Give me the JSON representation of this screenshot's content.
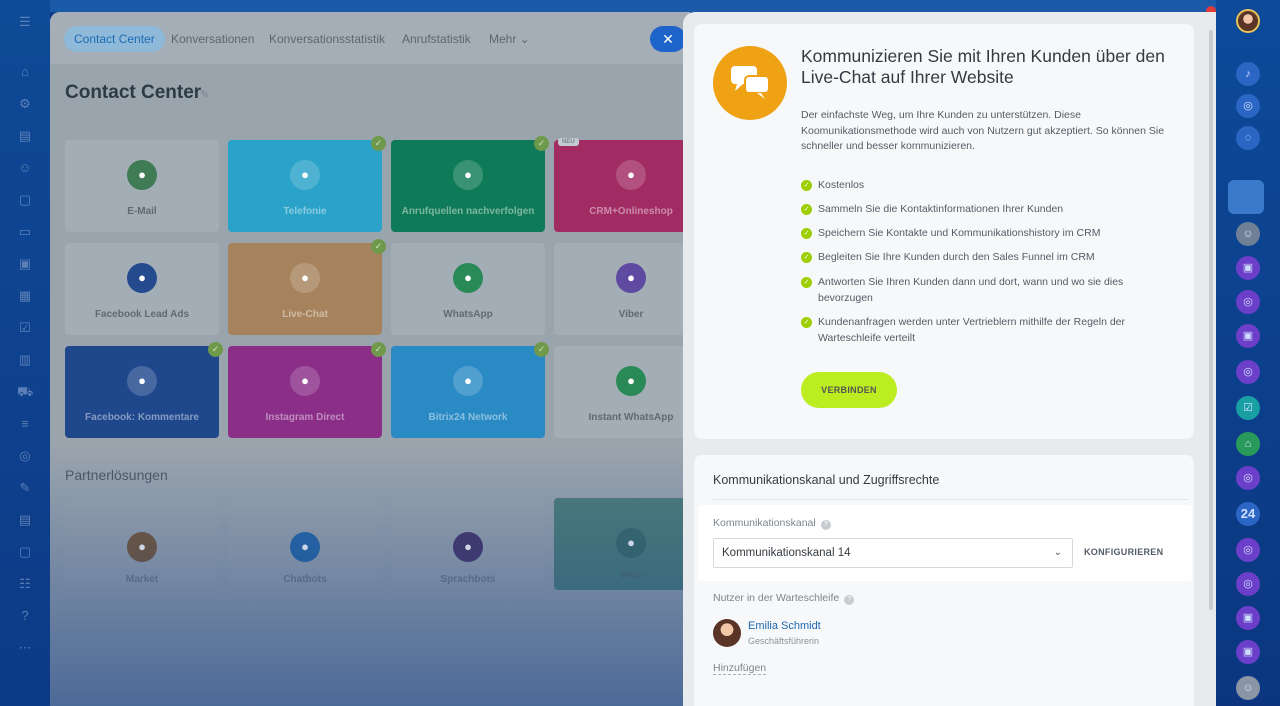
{
  "tabs": [
    {
      "label": "Contact Center"
    },
    {
      "label": "Konversationen"
    },
    {
      "label": "Konversationsstatistik"
    },
    {
      "label": "Anrufstatistik"
    },
    {
      "label": "Mehr ⌄"
    }
  ],
  "main": {
    "title": "Contact Center",
    "tiles": [
      {
        "label": "E-Mail",
        "icon": "envelope-icon",
        "color": "#3f7c56",
        "bg": "#a3adb5"
      },
      {
        "label": "Telefonie",
        "icon": "phone-icon",
        "color": "#2aa2c9",
        "bg": "#2aa2c9"
      },
      {
        "label": "Anrufquellen nachverfolgen",
        "icon": "call-tracking-icon",
        "color": "#0f7a57",
        "bg": "#0f7a57"
      },
      {
        "label": "CRM+Onlineshop",
        "icon": "cart-icon",
        "color": "#a12b63",
        "bg": "#a12b63"
      },
      {
        "label": "Facebook Lead Ads",
        "icon": "facebook-lead-icon",
        "color": "#244b8e",
        "bg": "#a3adb5"
      },
      {
        "label": "Live-Chat",
        "icon": "chat-icon",
        "color": "#a6835c",
        "bg": "#a6835c"
      },
      {
        "label": "WhatsApp",
        "icon": "whatsapp-icon",
        "color": "#2a8a57",
        "bg": "#a3adb5"
      },
      {
        "label": "Viber",
        "icon": "viber-icon",
        "color": "#5e4aa0",
        "bg": "#a3adb5"
      },
      {
        "label": "Facebook: Kommentare",
        "icon": "facebook-comments-icon",
        "color": "#1f478c",
        "bg": "#1f478c"
      },
      {
        "label": "Instagram Direct",
        "icon": "instagram-icon",
        "color": "#8a2e88",
        "bg": "#8a2e88"
      },
      {
        "label": "Bitrix24 Network",
        "icon": "cloud-icon",
        "color": "#2a8ac4",
        "bg": "#2a8ac4"
      },
      {
        "label": "Instant WhatsApp",
        "icon": "whatsapp-icon",
        "color": "#2a8a57",
        "bg": "#a3adb5"
      }
    ],
    "partner_title": "Partnerlösungen",
    "partner_tiles": [
      {
        "label": "Market",
        "icon": "market-icon"
      },
      {
        "label": "Chatbots",
        "icon": "bot-icon"
      },
      {
        "label": "Sprachbots",
        "icon": "mic-icon"
      },
      {
        "label": "Web",
        "icon": "box-icon"
      }
    ],
    "badge_new": "NEU"
  },
  "slider": {
    "headline": "Kommunizieren Sie mit Ihren Kunden über den Live-Chat auf Ihrer Website",
    "description": "Der einfachste Weg, um Ihre Kunden zu unterstützen. Diese Koomunikationsmethode wird auch von Nutzern gut akzeptiert. So können Sie schneller und besser kommunizieren.",
    "features": [
      "Kostenlos",
      "Sammeln Sie die Kontaktinformationen Ihrer Kunden",
      "Speichern Sie Kontakte und Kommunikationshistory im CRM",
      "Begleiten Sie Ihre Kunden durch den Sales Funnel im CRM",
      "Antworten Sie Ihren Kunden dann und dort, wann und wo sie dies bevorzugen",
      "Kundenanfragen werden unter Vertrieblern mithilfe der Regeln der Warteschleife verteilt"
    ],
    "connect_label": "VERBINDEN",
    "section_title": "Kommunikationskanal und Zugriffsrechte",
    "channel_label": "Kommunikationskanal",
    "channel_value": "Kommunikationskanal 14",
    "configure_label": "KONFIGURIEREN",
    "queue_label": "Nutzer in der Warteschleife",
    "user_name": "Emilia Schmidt",
    "user_role": "Geschäftsführerin",
    "add_label": "Hinzufügen"
  },
  "right_rail": {
    "counter_label": "24"
  },
  "colors": {
    "accent_green": "#bbed21",
    "chat_orange": "#efa214",
    "link_blue": "#2067b0"
  }
}
